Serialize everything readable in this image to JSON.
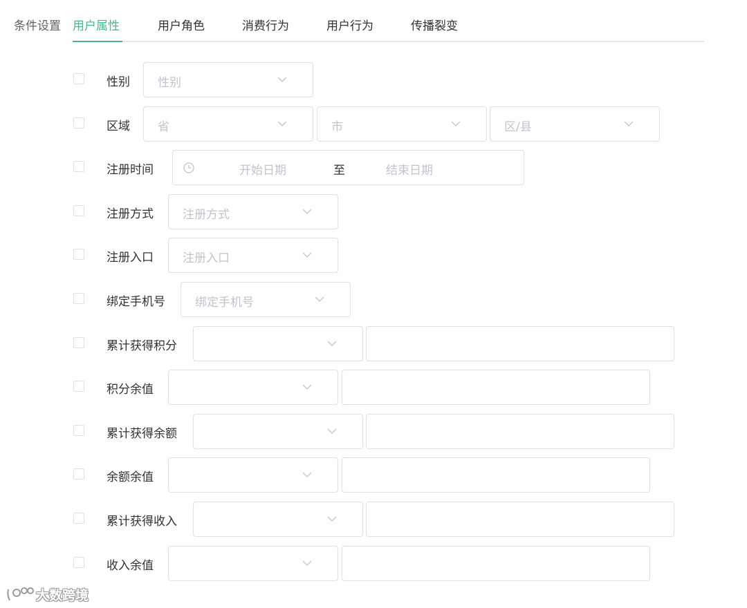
{
  "header": {
    "section_label": "条件设置",
    "tabs": [
      {
        "label": "用户属性",
        "active": true
      },
      {
        "label": "用户角色"
      },
      {
        "label": "消费行为"
      },
      {
        "label": "用户行为"
      },
      {
        "label": "传播裂变"
      }
    ]
  },
  "theme": {
    "accent": "#4cb392",
    "border": "#dcdfe6",
    "placeholder": "#c0c4cc",
    "text": "#303133"
  },
  "rows": [
    {
      "label": "性别",
      "select_placeholder": "性别"
    },
    {
      "label": "区域",
      "selects": [
        {
          "placeholder": "省"
        },
        {
          "placeholder": "市"
        },
        {
          "placeholder": "区/县"
        }
      ]
    },
    {
      "label": "注册时间",
      "range": {
        "start_placeholder": "开始日期",
        "separator": "至",
        "end_placeholder": "结束日期"
      }
    },
    {
      "label": "注册方式",
      "select_placeholder": "注册方式"
    },
    {
      "label": "注册入口",
      "select_placeholder": "注册入口"
    },
    {
      "label": "绑定手机号",
      "select_placeholder": "绑定手机号"
    },
    {
      "label": "累计获得积分",
      "select_placeholder": "",
      "input_value": ""
    },
    {
      "label": "积分余值",
      "select_placeholder": "",
      "input_value": ""
    },
    {
      "label": "累计获得余额",
      "select_placeholder": "",
      "input_value": ""
    },
    {
      "label": "余额余值",
      "select_placeholder": "",
      "input_value": ""
    },
    {
      "label": "累计获得收入",
      "select_placeholder": "",
      "input_value": ""
    },
    {
      "label": "收入余值",
      "select_placeholder": "",
      "input_value": ""
    }
  ],
  "watermark": {
    "text": "大数跨境"
  },
  "icons": {
    "dropdown": "chevron-down-icon",
    "date": "clock-icon",
    "checkbox": "checkbox"
  }
}
